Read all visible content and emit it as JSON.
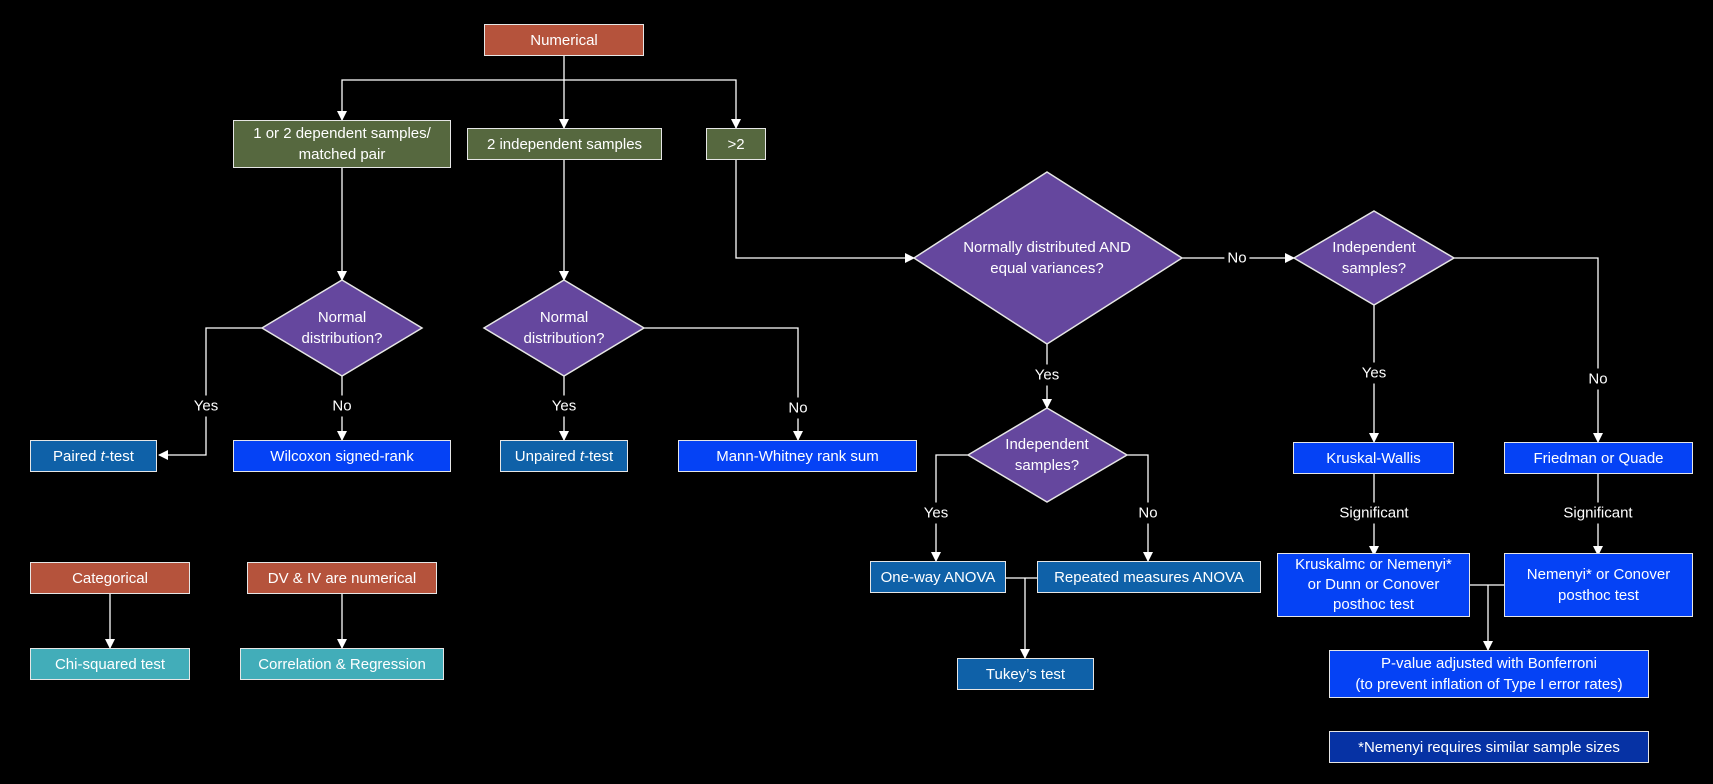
{
  "colors": {
    "background": "#000000",
    "category_box": "#b5533c",
    "sample_box": "#56683f",
    "decision_diamond": "#65479e",
    "parametric_test": "#0f61a8",
    "nonparametric_test": "#0542f5",
    "other_test": "#42adb9",
    "footnote_box": "#0632a4",
    "connector": "#ffffff"
  },
  "nodes": {
    "numerical": "Numerical",
    "dependent_samples": "1 or 2 dependent samples/\nmatched pair",
    "independent_samples_2": "2 independent samples",
    "more_than_two": ">2",
    "normal_dist_1": "Normal\ndistribution?",
    "normal_dist_2": "Normal\ndistribution?",
    "normal_equal_var": "Normally distributed AND\nequal variances?",
    "independent_q_anova": "Independent\nsamples?",
    "independent_q_nonparam": "Independent\nsamples?",
    "paired_t_prefix": "Paired ",
    "paired_t_italic": "t",
    "paired_t_suffix": "-test",
    "wilcoxon": "Wilcoxon signed-rank",
    "unpaired_t_prefix": "Unpaired ",
    "unpaired_t_italic": "t",
    "unpaired_t_suffix": "-test",
    "mann_whitney": "Mann-Whitney rank sum",
    "one_way_anova": "One-way ANOVA",
    "repeated_anova": "Repeated measures ANOVA",
    "tukey": "Tukey’s test",
    "kruskal_wallis": "Kruskal-Wallis",
    "friedman_quade": "Friedman or Quade",
    "kruskal_posthoc": "Kruskalmc or Nemenyi*\nor Dunn or Conover\nposthoc test",
    "nemenyi_posthoc": "Nemenyi* or Conover\nposthoc test",
    "bonferroni": "P-value adjusted with Bonferroni\n(to prevent inflation of Type I error rates)",
    "footnote": "*Nemenyi requires similar sample sizes",
    "categorical": "Categorical",
    "chi_squared": "Chi-squared test",
    "dv_iv_numerical": "DV & IV are numerical",
    "correlation_regression": "Correlation & Regression"
  },
  "edge_labels": {
    "yes": "Yes",
    "no": "No",
    "significant": "Significant"
  }
}
